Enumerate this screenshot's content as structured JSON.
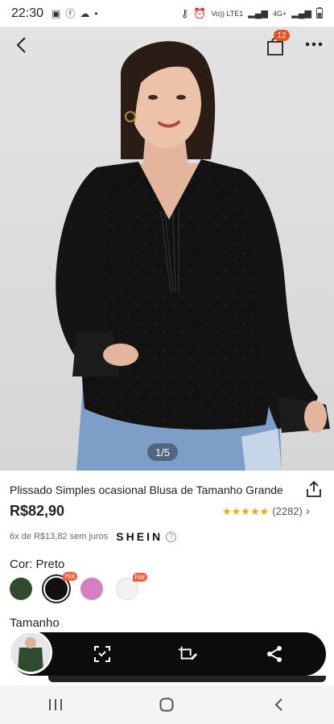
{
  "status_bar": {
    "time": "22:30",
    "carrier_text": "Vo)) LTE1",
    "network": "4G+"
  },
  "nav": {
    "bag_count": "12"
  },
  "gallery": {
    "pager": "1/5"
  },
  "product": {
    "title": "Plissado Simples ocasional Blusa de Tamanho Grande",
    "price": "R$82,90",
    "rating_value": 4.5,
    "rating_count": "(2282)",
    "installments": "6x de R$13,82 sem juros",
    "brand": "SHEIN"
  },
  "color": {
    "label": "Cor: Preto",
    "swatches": [
      {
        "name": "green",
        "color": "#2f4a2c",
        "hot": false,
        "selected": false
      },
      {
        "name": "black",
        "color": "#111111",
        "hot": true,
        "hot_label": "Hot",
        "selected": true
      },
      {
        "name": "pink",
        "color": "#d47fc0",
        "hot": false,
        "selected": false
      },
      {
        "name": "white",
        "color": "#f2f2f2",
        "hot": true,
        "hot_label": "Hot",
        "selected": false
      }
    ]
  },
  "size": {
    "label": "Tamanho"
  },
  "colors": {
    "accent": "#e8501d",
    "star": "#f6a700",
    "toolbar_bg": "#0c0c0c"
  }
}
